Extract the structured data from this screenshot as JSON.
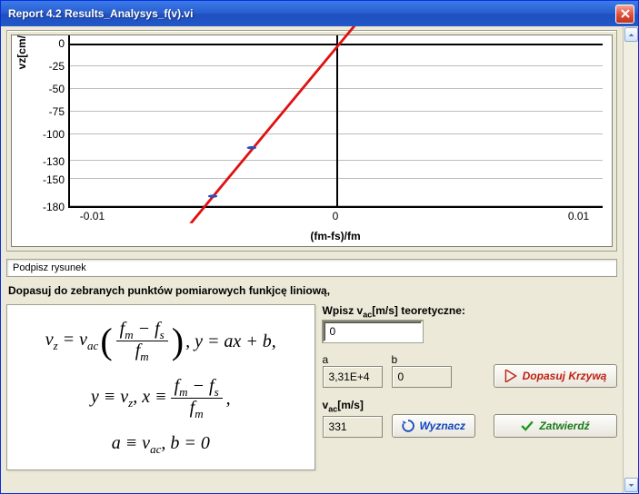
{
  "window": {
    "title": "Report 4.2 Results_Analysys_f(v).vi"
  },
  "chart_data": {
    "type": "line-with-points",
    "yaxis_title": "vz[cm/",
    "xaxis_title": "(fm-fs)/fm",
    "yticks": [
      0,
      -25,
      -50,
      -75,
      -100,
      -130,
      -150,
      -180
    ],
    "xticks": [
      -0.01,
      0,
      0.01
    ],
    "ylim": [
      -180,
      10
    ],
    "xlim": [
      -0.011,
      0.011
    ],
    "series": [
      {
        "name": "fit-line",
        "type": "line",
        "color": "#e01010",
        "points": [
          [
            -0.006,
            -200
          ],
          [
            0.0013,
            40
          ]
        ]
      },
      {
        "name": "data-points",
        "type": "scatter",
        "color": "#2a4fc0",
        "points": [
          [
            -0.0035,
            -116
          ],
          [
            -0.0051,
            -170
          ]
        ]
      }
    ]
  },
  "panels": {
    "caption_label": "Podpisz rysunek",
    "instruction": "Dopasuj do zebranych punktów pomiarowych funkjcę liniową,"
  },
  "inputs": {
    "vac_theor_label": "Wpisz vac[m/s] teoretyczne:",
    "vac_theor_value": "0",
    "a_label": "a",
    "a_value": "3,31E+4",
    "b_label": "b",
    "b_value": "0",
    "vac_label": "vac[m/s]",
    "vac_value": "331"
  },
  "buttons": {
    "fit": "Dopasuj Krzywą",
    "calc": "Wyznacz",
    "confirm": "Zatwierdź"
  },
  "equations": {
    "line1_pre": "v",
    "line1_sub1": "z",
    "line1_eq": " = v",
    "line1_sub2": "ac",
    "frac_num_a": "f",
    "frac_num_a_sub": "m",
    "frac_num_minus": " − f",
    "frac_num_b_sub": "s",
    "frac_den": "f",
    "frac_den_sub": "m",
    "line1_tail": ", y = ax + b,",
    "line2_pre": "y ≡ v",
    "line2_sub": "z",
    "line2_mid": ", x ≡ ",
    "line3": "a ≡ v",
    "line3_sub": "ac",
    "line3_tail": ", b = 0"
  }
}
